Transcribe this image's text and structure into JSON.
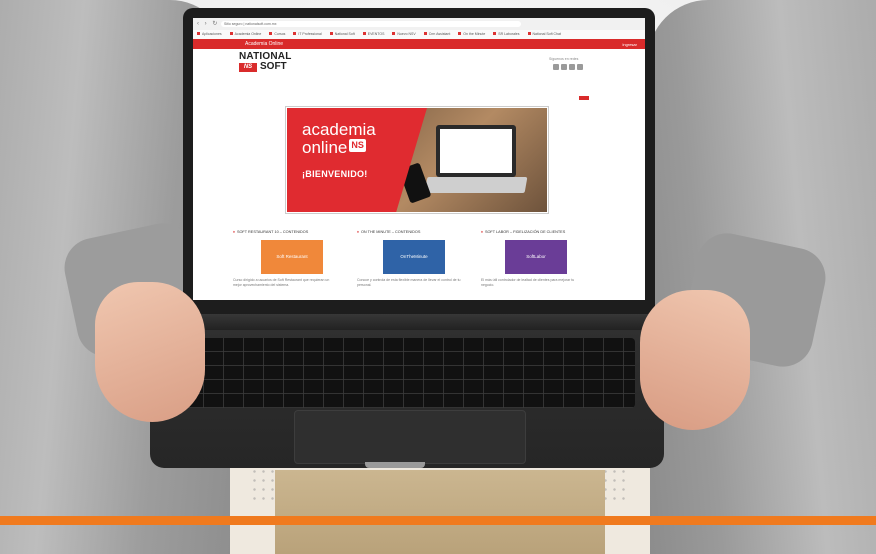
{
  "browser": {
    "url": "Sitio seguro | nationalsoft.com.mx",
    "bookmarks": [
      "Aplicaciones",
      "Academia Online",
      "Cursos",
      "IT Professional",
      "National Soft",
      "EVENTOS",
      "Nuevo NSV",
      "Crm Assistant",
      "On the Minute",
      "SR Laborales",
      "National Soft Chat"
    ]
  },
  "site": {
    "brand_bar": "Academia Online",
    "access": "Ingresar",
    "logo_line1": "NATIONAL",
    "logo_line2": "SOFT",
    "logo_mark": "NS",
    "social_label": "Síguenos en redes"
  },
  "banner": {
    "line1": "academia",
    "line2": "online",
    "badge": "NS",
    "welcome": "¡BIENVENIDO!"
  },
  "cards": [
    {
      "title": "SOFT RESTAURANT 10 – CONTENIDOS",
      "image_text": "Soft Restaurant",
      "color": "#f0883a",
      "desc": "Curso dirigido a usuarios de Soft Restaurant que requieran un mejor aprovechamiento del sistema."
    },
    {
      "title": "ON THE MINUTE – CONTENIDOS",
      "image_text": "OnTheMinute",
      "color": "#2f63a7",
      "desc": "Conoce y controla de esta flexible manera de llevar el control de tu personal."
    },
    {
      "title": "SOFT LABOR – FIDELIZACIÓN DE CLIENTES",
      "image_text": "SoftLabor",
      "color": "#6a3d97",
      "desc": "El más útil controlador de lealtad de clientes para mejorar tu negocio."
    }
  ],
  "colors": {
    "accent_red": "#d92b2b",
    "orange_bar": "#f07a1e"
  }
}
